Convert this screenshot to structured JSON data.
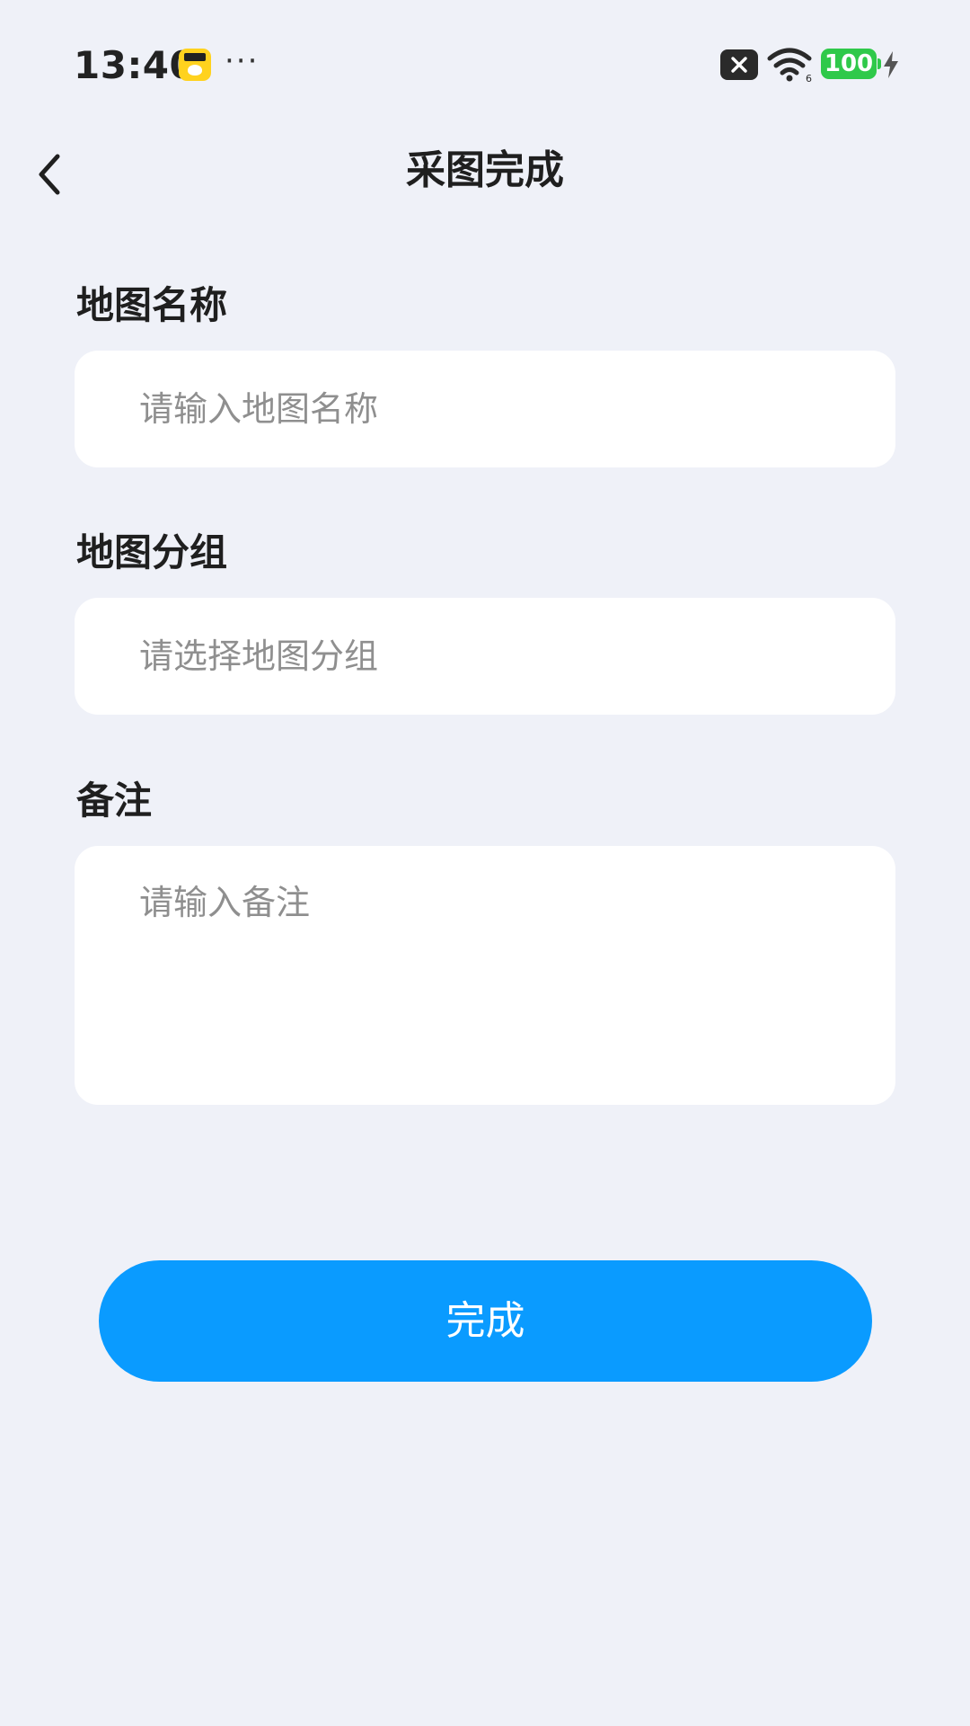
{
  "status_bar": {
    "time": "13:40",
    "more": "···",
    "battery": "100",
    "icons": [
      "app-badge-icon",
      "sim-disabled-icon",
      "wifi-icon",
      "battery-icon",
      "charging-bolt-icon"
    ]
  },
  "nav": {
    "title": "采图完成",
    "back_icon": "chevron-left-icon"
  },
  "form": {
    "map_name": {
      "label": "地图名称",
      "placeholder": "请输入地图名称",
      "value": ""
    },
    "map_group": {
      "label": "地图分组",
      "placeholder": "请选择地图分组",
      "value": ""
    },
    "notes": {
      "label": "备注",
      "placeholder": "请输入备注",
      "value": ""
    }
  },
  "actions": {
    "submit_label": "完成"
  },
  "colors": {
    "background": "#eff1f8",
    "primary": "#0a9bff",
    "field_background": "#ffffff",
    "placeholder": "#8f8f8f",
    "battery": "#2fc94a"
  }
}
